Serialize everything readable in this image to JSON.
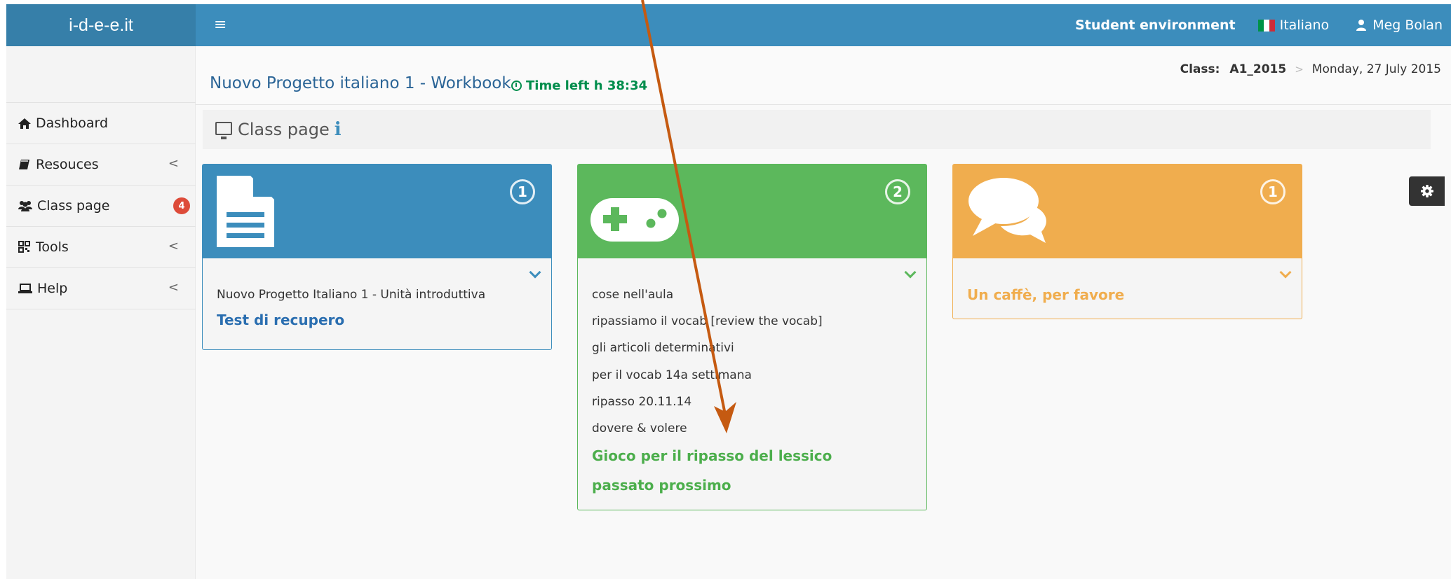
{
  "brand": {
    "logo_text": "i-d-e-e.it"
  },
  "topbar": {
    "menu_glyph": "≡",
    "environment": "Student environment",
    "language": "Italiano",
    "user_name": "Meg Bolan",
    "flag_colors": [
      "#009246",
      "#ffffff",
      "#ce2b37"
    ]
  },
  "sidebar": {
    "items": [
      {
        "label": "Dashboard",
        "icon": "home-icon"
      },
      {
        "label": "Resouces",
        "icon": "book-icon",
        "chevron": "<"
      },
      {
        "label": "Class page",
        "icon": "users-icon",
        "badge": "4"
      },
      {
        "label": "Tools",
        "icon": "qrcode-icon",
        "chevron": "<"
      },
      {
        "label": "Help",
        "icon": "laptop-icon",
        "chevron": "<"
      }
    ]
  },
  "header": {
    "title": "Nuovo Progetto italiano 1 - Workbook",
    "time_left": "Time left h 38:34",
    "breadcrumb": {
      "label": "Class:",
      "class_name": "A1_2015",
      "separator": ">",
      "date": "Monday, 27 July 2015"
    }
  },
  "class_bar": {
    "title": "Class page",
    "info_glyph": "i"
  },
  "boxes": {
    "blue": {
      "count": "1",
      "icon": "document-icon",
      "items": [
        "Nuovo Progetto Italiano 1 - Unità introduttiva"
      ],
      "link": "Test di recupero",
      "color": "#3c8dbc"
    },
    "green": {
      "count": "2",
      "icon": "gamepad-icon",
      "items": [
        "cose nell'aula",
        "ripassiamo il vocab [review the vocab]",
        "gli articoli determinativi",
        "per il vocab 14a settimana",
        "ripasso 20.11.14",
        "dovere & volere"
      ],
      "links": [
        "Gioco per il ripasso del lessico",
        "passato prossimo"
      ],
      "color": "#5cb85c"
    },
    "orange": {
      "count": "1",
      "icon": "chat-bubbles-icon",
      "link": "Un caffè, per favore",
      "color": "#f0ad4e"
    }
  },
  "settings": {
    "icon": "gear-icon"
  },
  "annotation": {
    "color": "#c55a11"
  }
}
